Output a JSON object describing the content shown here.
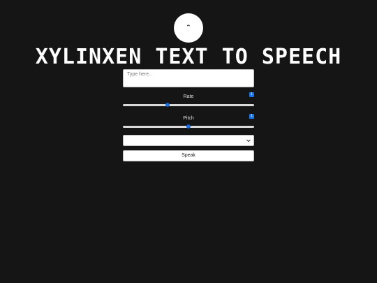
{
  "logo": {
    "mark": "ꞁ",
    "icon": "speaker-person-icon"
  },
  "title": "XYLINXEN TEXT TO SPEECH",
  "text_input": {
    "placeholder": "Type here..",
    "value": ""
  },
  "rate": {
    "label": "Rate",
    "value": "1",
    "fraction": 0.34
  },
  "pitch": {
    "label": "Pitch",
    "value": "1",
    "fraction": 0.5
  },
  "voice_select": {
    "selected": ""
  },
  "speak_button": {
    "label": "Speak"
  },
  "colors": {
    "background": "#151515",
    "accent": "#1a73e8",
    "title": "#ffffff"
  }
}
